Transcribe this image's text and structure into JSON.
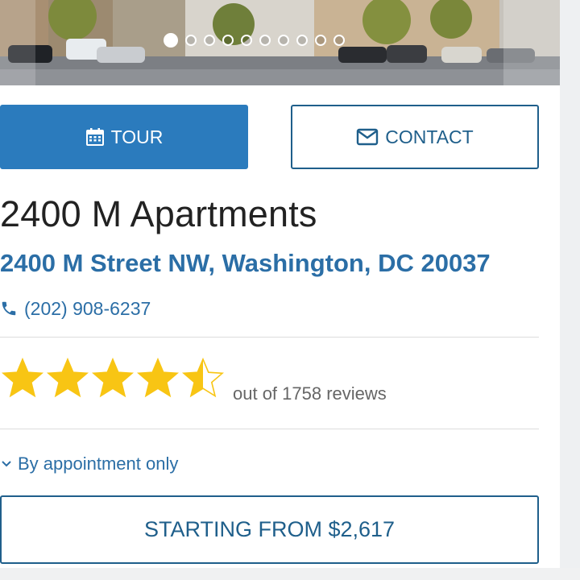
{
  "gallery": {
    "slide_count": 10,
    "active_slide": 1
  },
  "actions": {
    "tour_label": "TOUR",
    "contact_label": "CONTACT"
  },
  "property": {
    "name": "2400 M Apartments",
    "address": "2400 M Street NW, Washington, DC 20037",
    "phone": "(202) 908-6237"
  },
  "rating": {
    "stars": 4.5,
    "max_stars": 5,
    "reviews_text": "out of 1758 reviews"
  },
  "hours": {
    "label": "By appointment only"
  },
  "pricing": {
    "label": "STARTING FROM $2,617"
  },
  "colors": {
    "primary": "#2b7bbd",
    "accent_text": "#2b6ea6",
    "outline": "#1f5f8b",
    "star": "#f8c514"
  },
  "icons": {
    "tour": "calendar-icon",
    "contact": "envelope-icon",
    "phone": "phone-icon",
    "hours": "chevron-down-icon"
  }
}
